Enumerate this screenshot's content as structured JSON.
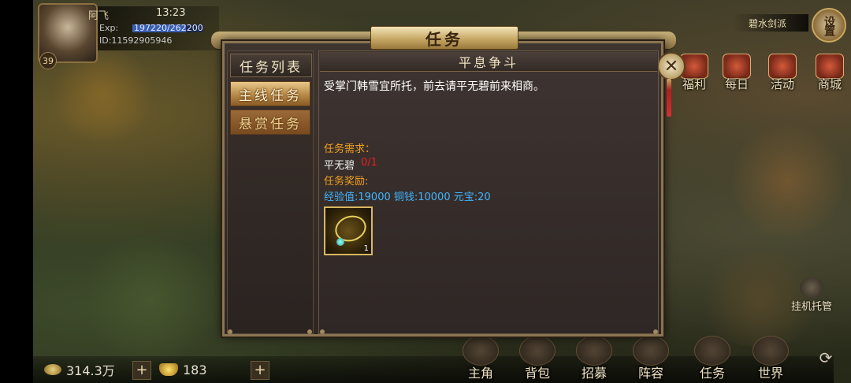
{
  "player": {
    "name": "阿飞",
    "time": "13:23",
    "exp_label": "Exp:",
    "exp_value": "197220/262200",
    "exp_fraction": 0.752,
    "id": "ID:11592905946",
    "level": "39"
  },
  "faction": "碧水剑派",
  "settings_label": "设置",
  "side_menu": [
    "福利",
    "每日",
    "活动",
    "商城"
  ],
  "currency": {
    "coins": "314.3万",
    "ingots": "183"
  },
  "bottom_menu": [
    "主角",
    "背包",
    "招募",
    "阵容",
    "任务",
    "世界"
  ],
  "auto_battle_label": "挂机托管",
  "dialog": {
    "title": "任务",
    "list_header": "任务列表",
    "tabs": [
      {
        "label": "主线任务",
        "active": true
      },
      {
        "label": "悬赏任务",
        "active": false
      }
    ],
    "quest": {
      "name": "平息争斗",
      "description": "受掌门韩雪宜所托，前去请平无碧前来相商。",
      "requirement_label": "任务需求：",
      "requirement_target": "平无碧",
      "requirement_progress": "0/1",
      "reward_label": "任务奖励:",
      "reward_values": "经验值:19000 铜钱:10000 元宝:20",
      "reward_item_qty": "1"
    }
  },
  "colors": {
    "requirement": "#f0a020",
    "progress": "#e02020",
    "reward": "#40b4ff"
  }
}
